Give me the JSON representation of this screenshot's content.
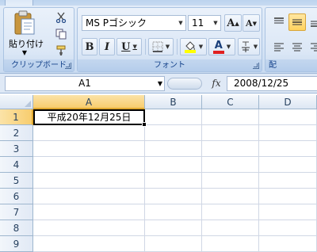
{
  "ribbon": {
    "clipboard": {
      "paste_label": "貼り付け",
      "group_label": "クリップボード"
    },
    "font": {
      "font_name": "MS Pゴシック",
      "font_size": "11",
      "bold_label": "B",
      "italic_label": "I",
      "underline_label": "U",
      "grow_label": "A",
      "shrink_label": "A",
      "font_color_label": "A",
      "group_label": "フォント",
      "font_color": "#e02020",
      "highlight_color": "#ffff00"
    },
    "alignment": {
      "group_label": "配"
    }
  },
  "formula_bar": {
    "name_box": "A1",
    "fx_label": "fx",
    "value": "2008/12/25"
  },
  "sheet": {
    "columns": [
      "A",
      "B",
      "C",
      "D"
    ],
    "rows": [
      "1",
      "2",
      "3",
      "4",
      "5",
      "6",
      "7",
      "8",
      "9"
    ],
    "active_cell_text": "平成20年12月25日"
  }
}
